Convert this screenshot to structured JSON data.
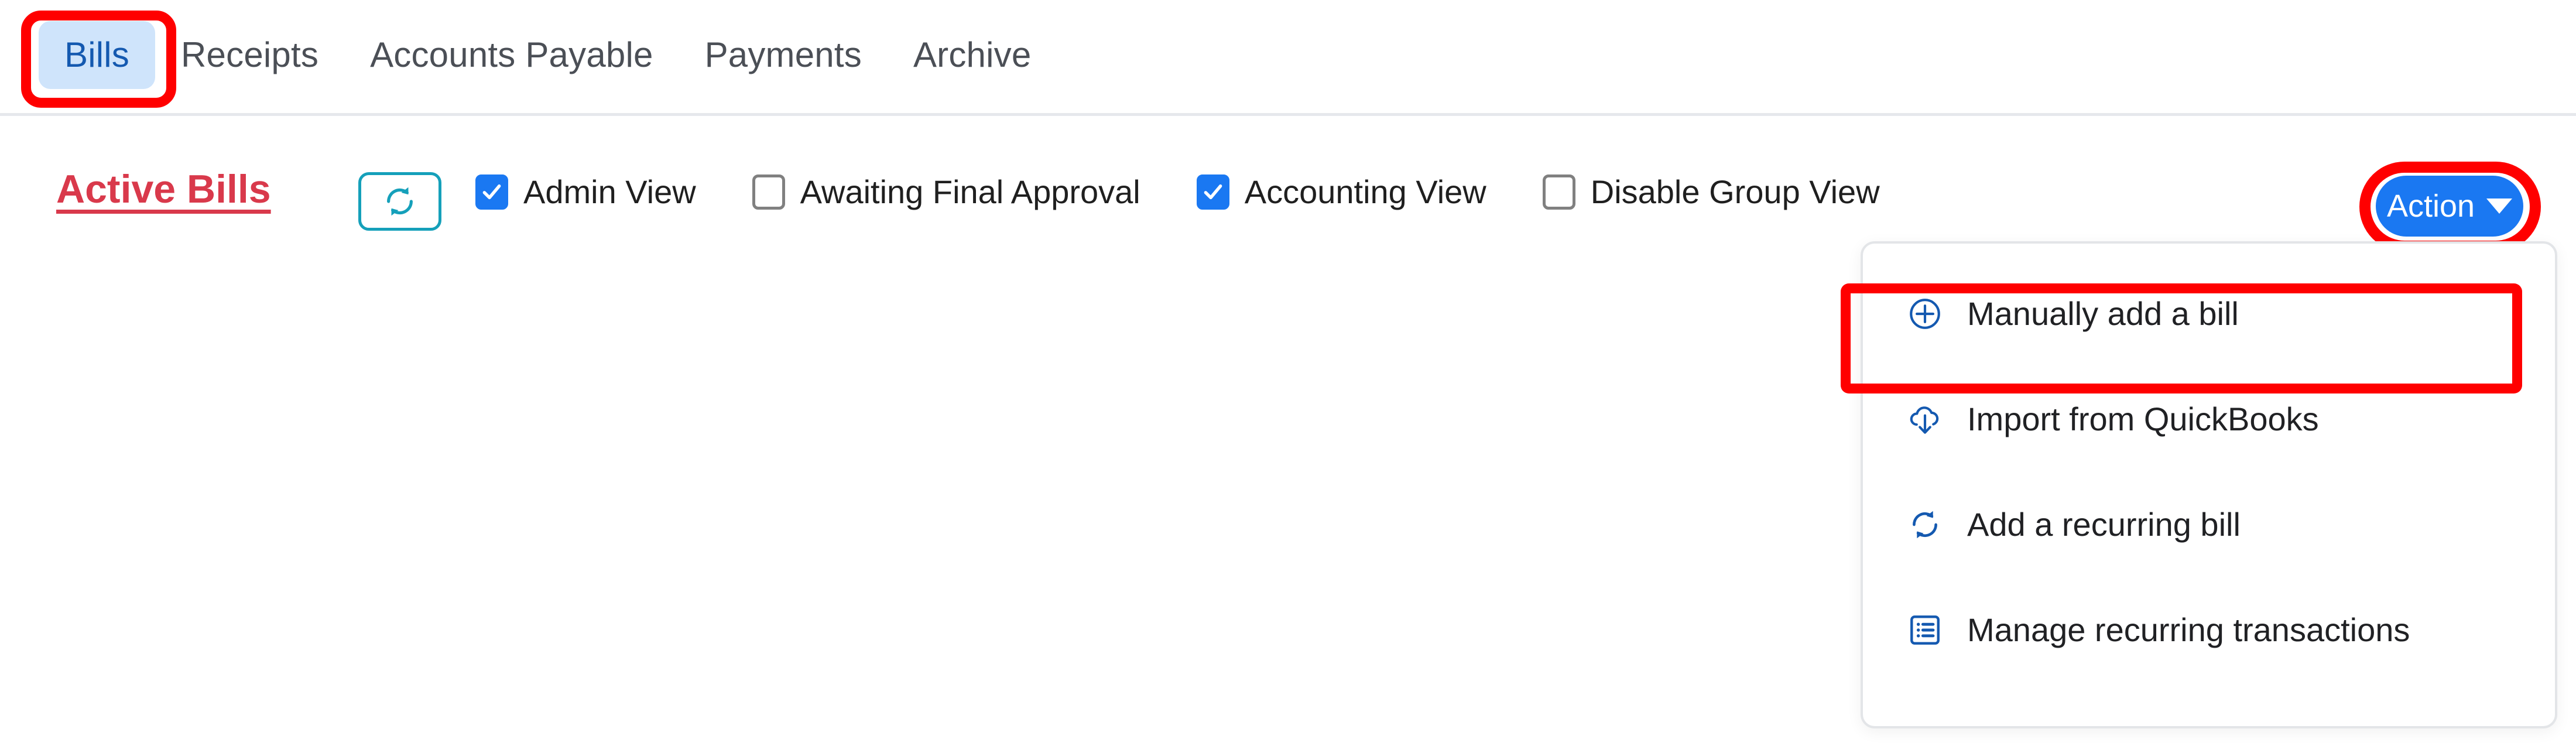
{
  "tabs": [
    {
      "label": "Bills",
      "active": true
    },
    {
      "label": "Receipts",
      "active": false
    },
    {
      "label": "Accounts Payable",
      "active": false
    },
    {
      "label": "Payments",
      "active": false
    },
    {
      "label": "Archive",
      "active": false
    }
  ],
  "toolbar": {
    "page_title": "Active Bills",
    "refresh_icon": "refresh-icon",
    "checkboxes": [
      {
        "label": "Admin View",
        "checked": true
      },
      {
        "label": "Awaiting Final Approval",
        "checked": false
      },
      {
        "label": "Accounting View",
        "checked": true
      },
      {
        "label": "Disable Group View",
        "checked": false
      }
    ],
    "action_button": {
      "label": "Action",
      "caret_icon": "chevron-down-icon"
    }
  },
  "action_menu": {
    "items": [
      {
        "label": "Manually add a bill",
        "icon": "plus-circle-icon",
        "highlighted": true
      },
      {
        "label": "Import from QuickBooks",
        "icon": "cloud-download-icon",
        "highlighted": false
      },
      {
        "label": "Add a recurring bill",
        "icon": "recurring-arrows-icon",
        "highlighted": false
      },
      {
        "label": "Manage recurring transactions",
        "icon": "list-icon",
        "highlighted": false
      }
    ]
  },
  "colors": {
    "tab_active_bg": "#cfe4fb",
    "tab_active_text": "#1459b0",
    "page_title": "#d9394b",
    "accent_blue": "#1a78f2",
    "refresh_teal": "#15a0ba",
    "annotation_red": "#ff0000",
    "menu_icon_blue": "#1459b0"
  }
}
